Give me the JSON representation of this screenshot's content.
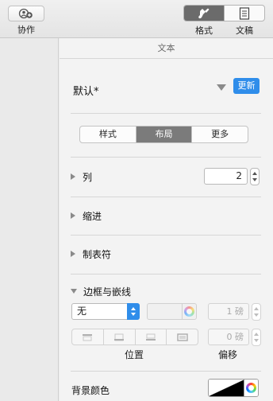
{
  "toolbar": {
    "collab_label": "协作",
    "format_label": "格式",
    "document_label": "文稿"
  },
  "inspector": {
    "title": "文本",
    "paragraph_style": "默认*",
    "update_label": "更新",
    "tabs": [
      {
        "label": "样式",
        "active": false
      },
      {
        "label": "布局",
        "active": true
      },
      {
        "label": "更多",
        "active": false
      }
    ],
    "columns": {
      "label": "列",
      "value": "2"
    },
    "indent_label": "缩进",
    "tabs_section_label": "制表符",
    "borders": {
      "label": "边框与嵌线",
      "style_value": "无",
      "width_value": "1 磅",
      "offset_value": "0 磅",
      "position_label": "位置",
      "offset_label": "偏移"
    },
    "background": {
      "label": "背景颜色"
    }
  },
  "colors": {
    "accent": "#2f8dea",
    "active_tab": "#7b7b7b"
  }
}
